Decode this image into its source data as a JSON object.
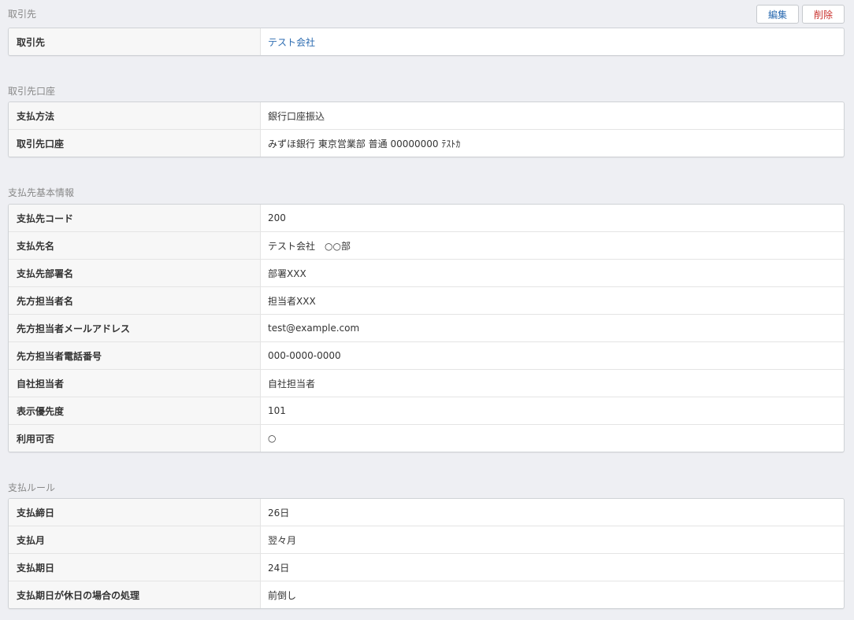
{
  "toolbar": {
    "edit_label": "編集",
    "delete_label": "削除"
  },
  "sections": [
    {
      "title": "取引先",
      "rows": [
        {
          "label": "取引先",
          "value": "テスト会社",
          "link": true
        }
      ]
    },
    {
      "title": "取引先口座",
      "rows": [
        {
          "label": "支払方法",
          "value": "銀行口座振込"
        },
        {
          "label": "取引先口座",
          "value": "みずほ銀行 東京営業部 普通 00000000 ﾃｽﾄｶ"
        }
      ]
    },
    {
      "title": "支払先基本情報",
      "rows": [
        {
          "label": "支払先コード",
          "value": "200"
        },
        {
          "label": "支払先名",
          "value": "テスト会社　○○部"
        },
        {
          "label": "支払先部署名",
          "value": "部署XXX"
        },
        {
          "label": "先方担当者名",
          "value": "担当者XXX"
        },
        {
          "label": "先方担当者メールアドレス",
          "value": "test@example.com"
        },
        {
          "label": "先方担当者電話番号",
          "value": "000-0000-0000"
        },
        {
          "label": "自社担当者",
          "value": "自社担当者"
        },
        {
          "label": "表示優先度",
          "value": "101"
        },
        {
          "label": "利用可否",
          "value": "○"
        }
      ]
    },
    {
      "title": "支払ルール",
      "rows": [
        {
          "label": "支払締日",
          "value": "26日"
        },
        {
          "label": "支払月",
          "value": "翌々月"
        },
        {
          "label": "支払期日",
          "value": "24日"
        },
        {
          "label": "支払期日が休日の場合の処理",
          "value": "前倒し"
        }
      ]
    }
  ]
}
